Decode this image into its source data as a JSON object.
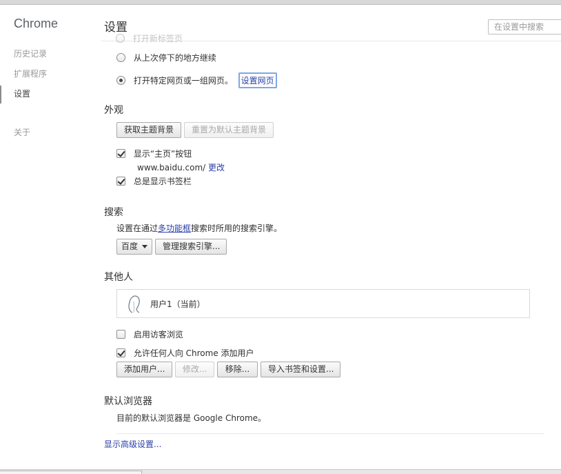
{
  "sidebar": {
    "app_title": "Chrome",
    "items": [
      {
        "label": "历史记录"
      },
      {
        "label": "扩展程序"
      },
      {
        "label": "设置"
      },
      {
        "label": "关于"
      }
    ]
  },
  "header": {
    "title": "设置",
    "search_placeholder": "在设置中搜索"
  },
  "startup": {
    "faded_option": "打开新标签页",
    "options": [
      {
        "label": "从上次停下的地方继续",
        "checked": false
      },
      {
        "label": "打开特定网页或一组网页。",
        "checked": true
      }
    ],
    "set_pages_link": "设置网页"
  },
  "appearance": {
    "title": "外观",
    "get_themes_button": "获取主题背景",
    "reset_theme_button": "重置为默认主题背景",
    "show_home_button": {
      "label": "显示“主页”按钮",
      "checked": true
    },
    "home_url": "www.baidu.com/",
    "change_link": "更改",
    "show_bookmarks_bar": {
      "label": "总是显示书签栏",
      "checked": true
    }
  },
  "search": {
    "title": "搜索",
    "desc_before": "设置在通过",
    "desc_link": "多功能框",
    "desc_after": "搜索时所用的搜索引擎。",
    "engine_selected": "百度",
    "manage_button": "管理搜索引擎..."
  },
  "people": {
    "title": "其他人",
    "current_user": "用户1（当前）",
    "guest_browsing": {
      "label": "启用访客浏览",
      "checked": false
    },
    "allow_anyone": {
      "label": "允许任何人向 Chrome 添加用户",
      "checked": true
    },
    "buttons": {
      "add": "添加用户...",
      "edit": "修改...",
      "remove": "移除...",
      "import": "导入书签和设置..."
    }
  },
  "default_browser": {
    "title": "默认浏览器",
    "status": "目前的默认浏览器是 Google Chrome。"
  },
  "advanced_link": "显示高级设置..."
}
